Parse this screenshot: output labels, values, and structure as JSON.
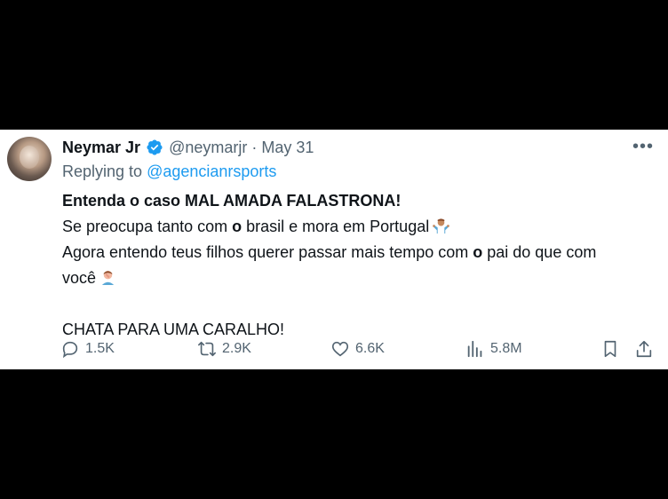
{
  "tweet": {
    "author_name": "Neymar Jr",
    "handle": "@neymarjr",
    "separator": "·",
    "date": "May 31",
    "more": "•••",
    "replying_to_label": "Replying to",
    "replying_to_handle": "@agencianrsports",
    "lines": {
      "l1": "Entenda o caso MAL AMADA FALASTRONA!",
      "l2a": "Se preocupa tanto com ",
      "l2b": "o",
      "l2c": " brasil e mora em Portugal",
      "l3a": "Agora entendo teus filhos querer passar mais tempo com ",
      "l3b": "o",
      "l3c": " pai do que com",
      "l4": "você",
      "l6": "CHATA PARA UMA CARALHO!"
    }
  },
  "emojis": [
    "person-shrugging-emoji",
    "person-facepalming-emoji"
  ],
  "actions": {
    "replies": "1.5K",
    "reposts": "2.9K",
    "likes": "6.6K",
    "views": "5.8M"
  },
  "colors": {
    "link": "#1d9bf0",
    "muted": "#536471",
    "text": "#0f1419",
    "verified": "#1d9bf0"
  }
}
